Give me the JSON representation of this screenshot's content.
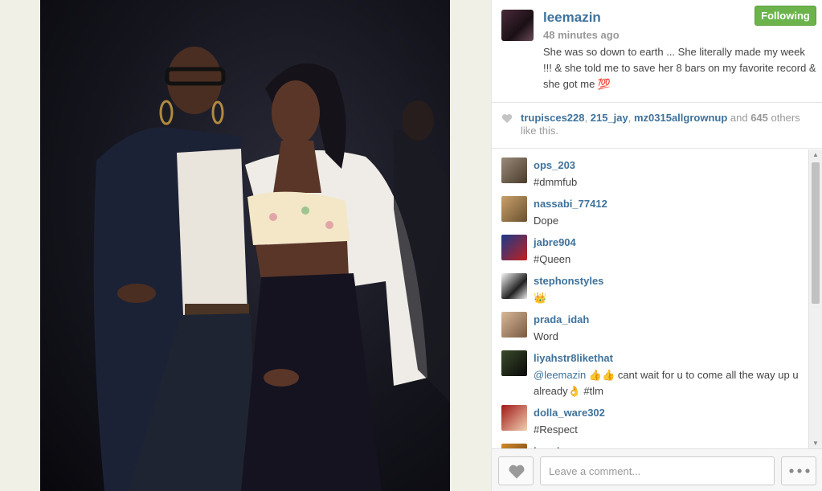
{
  "post": {
    "owner": "leemazin",
    "time": "48 minutes ago",
    "caption": "She was so down to earth ... She literally made my week !!! & she told me to save her 8 bars on my favorite record & she got me 💯",
    "follow_label": "Following"
  },
  "likes": {
    "users": [
      "trupisces228",
      "215_jay",
      "mz0315allgrownup"
    ],
    "sep1": ", ",
    "sep2": ", ",
    "and_word": " and ",
    "count": "645",
    "suffix": " others like this."
  },
  "comments": [
    {
      "user": "ops_203",
      "text": "#dmmfub"
    },
    {
      "user": "nassabi_77412",
      "text": "Dope"
    },
    {
      "user": "jabre904",
      "text": "#Queen"
    },
    {
      "user": "stephonstyles",
      "text": "👑"
    },
    {
      "user": "prada_idah",
      "text": "Word"
    },
    {
      "user": "liyahstr8likethat",
      "mention": "@leemazin",
      "text": " 👍👍 cant wait for u to come all the way up u already👌 #tlm"
    },
    {
      "user": "dolla_ware302",
      "text": "#Respect"
    },
    {
      "user": "kev_luv",
      "text": ""
    }
  ],
  "footer": {
    "comment_placeholder": "Leave a comment..."
  },
  "icons": {
    "like": "heart-icon",
    "more": "ellipsis-icon",
    "scroll_up": "arrow-up-icon",
    "scroll_down": "arrow-down-icon"
  },
  "colors": {
    "username": "#3f729b",
    "follow_button": "#6bb34a",
    "muted_text": "#999999"
  }
}
